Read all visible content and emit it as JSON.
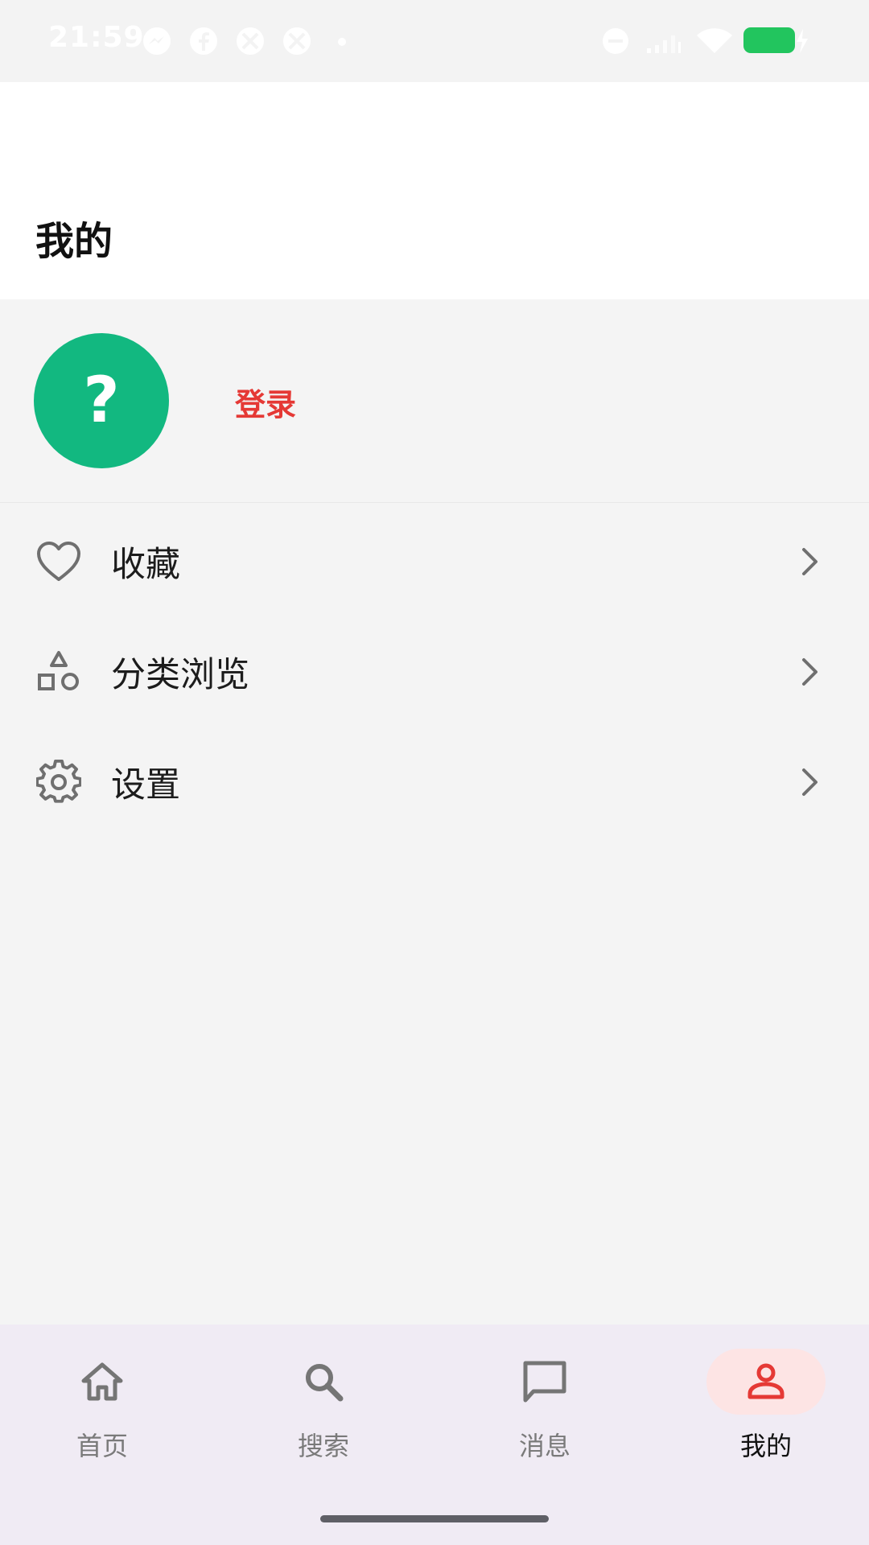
{
  "status_bar": {
    "time": "21:59",
    "left_icons": [
      "messenger-icon",
      "facebook-icon",
      "app-icon",
      "app-icon",
      "dot-icon"
    ],
    "right_icons": [
      "do-not-disturb-icon",
      "signal-icon",
      "wifi-icon",
      "battery-charging-icon"
    ],
    "battery_color": "#22c55e"
  },
  "header": {
    "title": "我的"
  },
  "profile": {
    "avatar_glyph": "?",
    "avatar_color": "#12b880",
    "login_label": "登录",
    "login_color": "#e53935"
  },
  "menu": {
    "items": [
      {
        "label": "收藏",
        "icon": "heart-icon"
      },
      {
        "label": "分类浏览",
        "icon": "category-shapes-icon"
      },
      {
        "label": "设置",
        "icon": "gear-icon"
      }
    ]
  },
  "bottom_nav": {
    "items": [
      {
        "label": "首页",
        "icon": "home-icon"
      },
      {
        "label": "搜索",
        "icon": "search-icon"
      },
      {
        "label": "消息",
        "icon": "message-icon"
      },
      {
        "label": "我的",
        "icon": "person-icon",
        "active": true
      }
    ],
    "active_color": "#e53935"
  }
}
